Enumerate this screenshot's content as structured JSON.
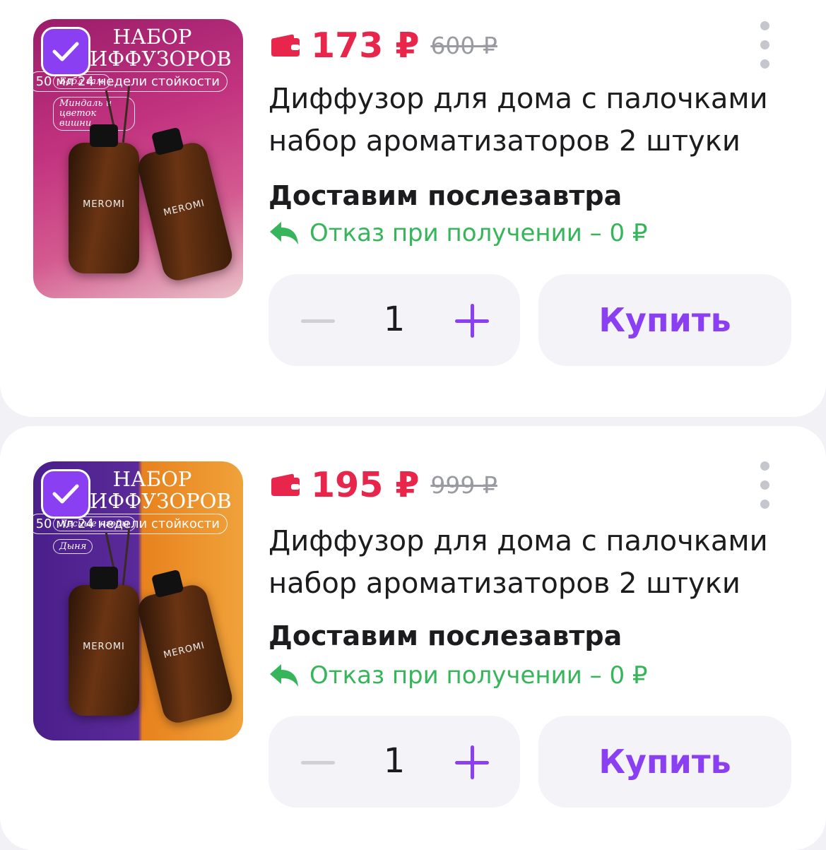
{
  "colors": {
    "accent": "#8b3ff2",
    "price": "#e8254a",
    "refund": "#37b55a",
    "old_price": "#9a9aa2"
  },
  "products": [
    {
      "price": "173 ₽",
      "old_price": "600 ₽",
      "title": "Диффузор для дома с палочками набор ароматизаторов 2 штуки",
      "delivery": "Доставим послезавтра",
      "refund": "Отказ при получении – 0 ₽",
      "quantity": "1",
      "buy_label": "Купить",
      "selected": true,
      "image": {
        "heading": "НАБОР ДИФФУЗОРОВ",
        "chip1": "Бабл гам",
        "chip2": "Миндаль и цветок вишни",
        "volume": "50 мл 24 недели стойкости",
        "bottle1": "MEROMI",
        "bottle2": "MEROMI"
      }
    },
    {
      "price": "195 ₽",
      "old_price": "999 ₽",
      "title": "Диффузор для дома с палочками набор ароматизаторов 2 штуки",
      "delivery": "Доставим послезавтра",
      "refund": "Отказ при получении – 0 ₽",
      "quantity": "1",
      "buy_label": "Купить",
      "selected": true,
      "image": {
        "heading": "НАБОР ДИФФУЗОРОВ",
        "chip1": "Лесные ягоды",
        "chip2": "Дыня",
        "volume": "50 мл 24 недели стойкости",
        "bottle1": "MEROMI",
        "bottle2": "MEROMI"
      }
    }
  ]
}
